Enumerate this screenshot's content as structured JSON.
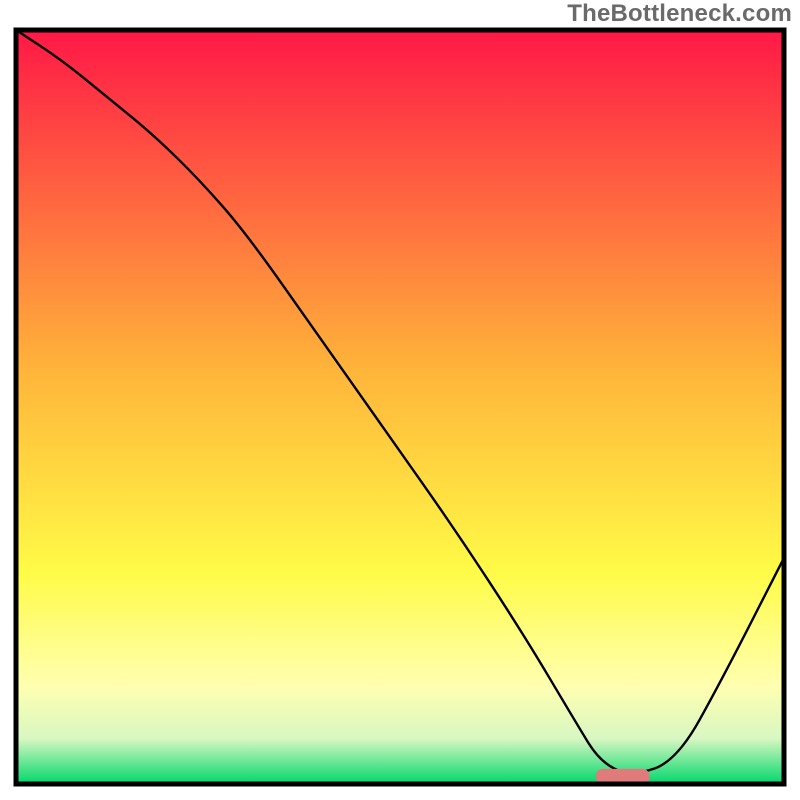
{
  "watermark": "TheBottleneck.com",
  "chart_data": {
    "type": "line",
    "title": "",
    "xlabel": "",
    "ylabel": "",
    "xlim": [
      0,
      100
    ],
    "ylim": [
      0,
      100
    ],
    "grid": false,
    "legend": false,
    "background_gradient": {
      "stops": [
        {
          "offset": 0.0,
          "color": "#ff1846"
        },
        {
          "offset": 0.45,
          "color": "#ffb43a"
        },
        {
          "offset": 0.72,
          "color": "#fffb47"
        },
        {
          "offset": 0.87,
          "color": "#ffffb0"
        },
        {
          "offset": 0.94,
          "color": "#d8f7c2"
        },
        {
          "offset": 1.0,
          "color": "#00d76b"
        }
      ]
    },
    "series": [
      {
        "name": "bottleneck-curve",
        "x": [
          0,
          6,
          12,
          18,
          24,
          30,
          39,
          48,
          57,
          66,
          73,
          76,
          80,
          86,
          92,
          100
        ],
        "y": [
          100,
          96,
          91,
          86,
          80,
          73,
          60,
          47,
          34,
          20,
          8,
          3,
          1,
          3,
          14,
          30
        ]
      }
    ],
    "marker": {
      "name": "optimal-range-marker",
      "x": 79,
      "y": 1,
      "width": 7,
      "height": 2,
      "color": "#e17a7a"
    }
  }
}
